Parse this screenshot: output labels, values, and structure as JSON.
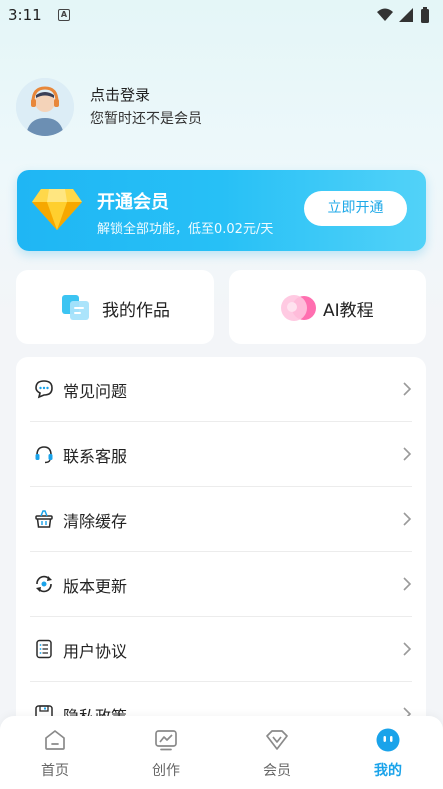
{
  "status_bar": {
    "time": "3:11",
    "notification_icon": "A"
  },
  "profile": {
    "login_text": "点击登录",
    "member_status": "您暂时还不是会员"
  },
  "vip": {
    "title": "开通会员",
    "subtitle": "解锁全部功能，低至0.02元/天",
    "button": "立即开通"
  },
  "cards": {
    "works": "我的作品",
    "ai_tutorial": "AI教程"
  },
  "menu": [
    {
      "label": "常见问题",
      "icon": "chat-bubble-icon"
    },
    {
      "label": "联系客服",
      "icon": "headset-icon"
    },
    {
      "label": "清除缓存",
      "icon": "basket-icon"
    },
    {
      "label": "版本更新",
      "icon": "refresh-icon"
    },
    {
      "label": "用户协议",
      "icon": "document-list-icon"
    },
    {
      "label": "隐私政策",
      "icon": "floppy-icon"
    }
  ],
  "nav": [
    {
      "label": "首页",
      "icon": "home-icon",
      "active": false
    },
    {
      "label": "创作",
      "icon": "chart-icon",
      "active": false
    },
    {
      "label": "会员",
      "icon": "vip-icon",
      "active": false
    },
    {
      "label": "我的",
      "icon": "profile-face-icon",
      "active": true
    }
  ],
  "colors": {
    "accent": "#1aa3ea",
    "vip_gradient_start": "#1fb6f4",
    "vip_gradient_end": "#52d2f8"
  }
}
